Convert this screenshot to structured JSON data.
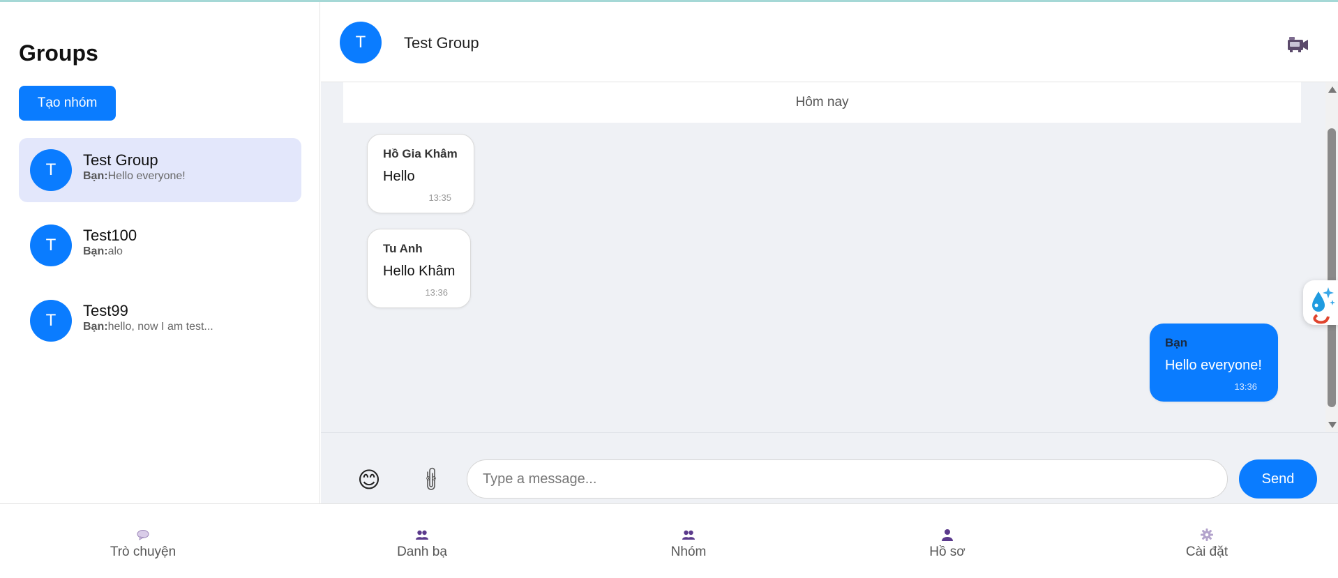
{
  "sidebar": {
    "title": "Groups",
    "create_button": "Tạo nhóm",
    "groups": [
      {
        "avatar": "T",
        "name": "Test Group",
        "sender": "Bạn:",
        "last_message": "Hello everyone!",
        "active": true
      },
      {
        "avatar": "T",
        "name": "Test100",
        "sender": "Bạn:",
        "last_message": "alo",
        "active": false
      },
      {
        "avatar": "T",
        "name": "Test99",
        "sender": "Bạn:",
        "last_message": "hello, now I am test...",
        "active": false
      }
    ]
  },
  "chat": {
    "avatar": "T",
    "title": "Test Group",
    "video_icon": "video-camera-icon",
    "date_separator": "Hôm nay",
    "messages": [
      {
        "sender": "Hồ Gia Khâm",
        "text": "Hello",
        "time": "13:35",
        "mine": false
      },
      {
        "sender": "Tu Anh",
        "text": "Hello Khâm",
        "time": "13:36",
        "mine": false
      },
      {
        "sender": "Bạn",
        "text": "Hello everyone!",
        "time": "13:36",
        "mine": true
      }
    ]
  },
  "composer": {
    "emoji_icon": "😊",
    "attach_icon": "paperclip-icon",
    "placeholder": "Type a message...",
    "send_label": "Send"
  },
  "bottom_nav": [
    {
      "label": "Trò chuyện",
      "icon": "chat-bubble-icon"
    },
    {
      "label": "Danh bạ",
      "icon": "contacts-icon"
    },
    {
      "label": "Nhóm",
      "icon": "group-icon"
    },
    {
      "label": "Hồ sơ",
      "icon": "profile-icon"
    },
    {
      "label": "Cài đặt",
      "icon": "settings-gear-icon"
    }
  ],
  "colors": {
    "accent": "#0a7cff",
    "active_group_bg": "#e3e7fb",
    "chat_bg": "#eff1f5",
    "nav_icon": "#5b3a8c"
  }
}
